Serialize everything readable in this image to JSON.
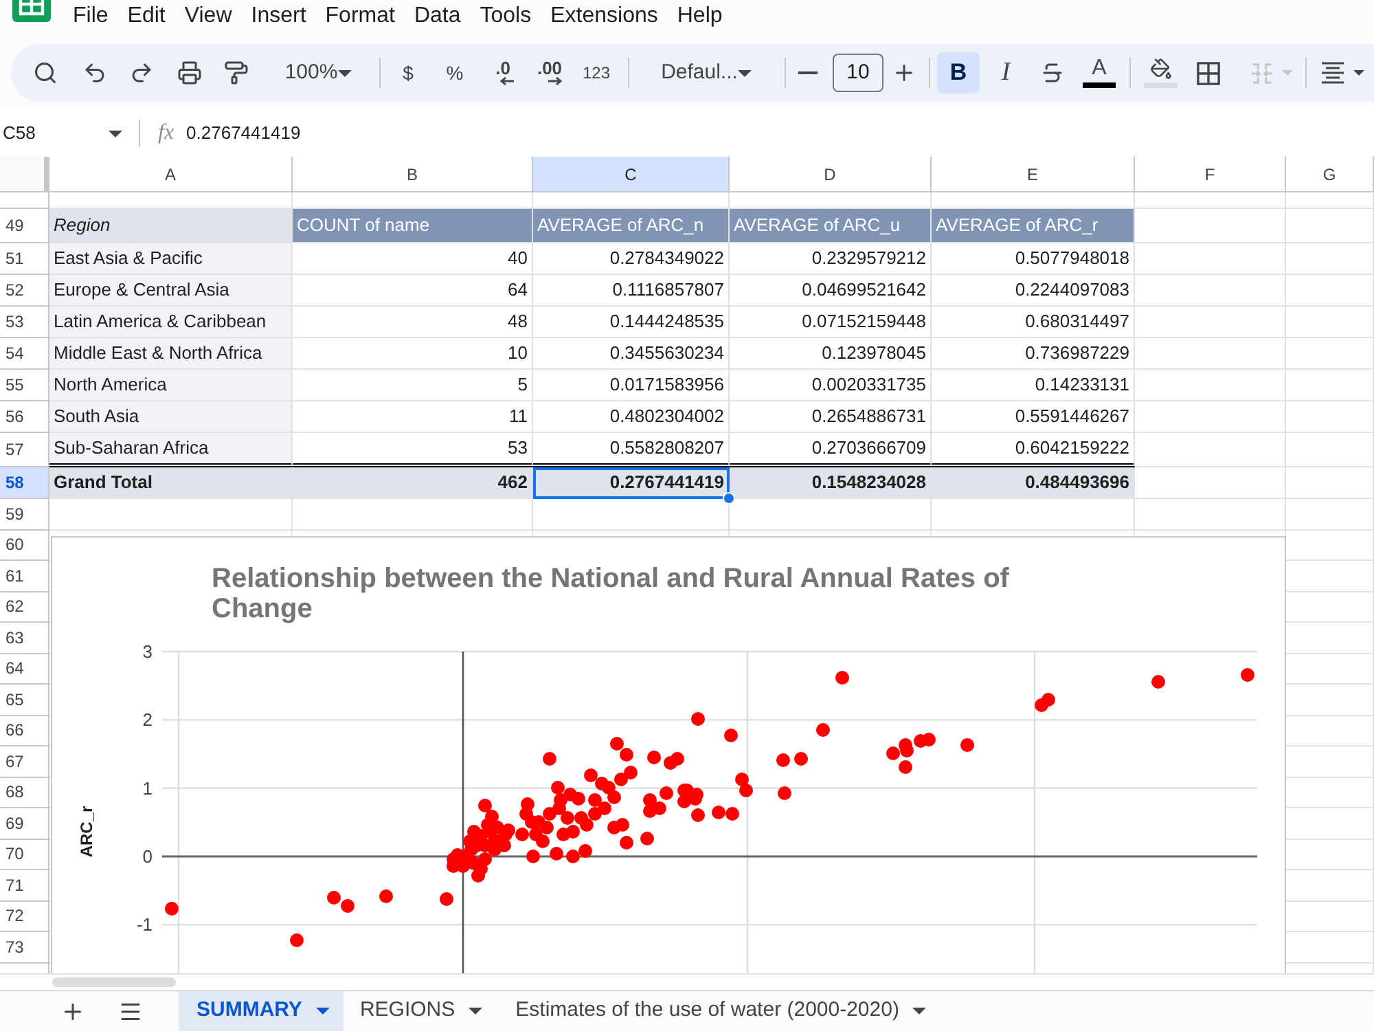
{
  "menu": [
    "File",
    "Edit",
    "View",
    "Insert",
    "Format",
    "Data",
    "Tools",
    "Extensions",
    "Help"
  ],
  "toolbar": {
    "zoom": "100%",
    "currency": "$",
    "percent": "%",
    "decrease_decimals": ".0",
    "increase_decimals": ".00",
    "number_format": "123",
    "font": "Defaul...",
    "font_size": "10",
    "styles": [
      {
        "kind": "bold",
        "label": "B",
        "selected": true
      },
      {
        "kind": "italic",
        "label": "I",
        "selected": false
      }
    ],
    "text_color": "A",
    "merge": {
      "disabled": true
    }
  },
  "formula_bar": {
    "cell_reference": "C58",
    "function_label": "fx",
    "value": "0.2767441419"
  },
  "grid": {
    "columns": [
      {
        "label": "A",
        "selected": false
      },
      {
        "label": "B",
        "selected": false
      },
      {
        "label": "C",
        "selected": true
      },
      {
        "label": "D",
        "selected": false
      },
      {
        "label": "E",
        "selected": false
      },
      {
        "label": "F",
        "selected": false
      },
      {
        "label": "G",
        "selected": false
      }
    ],
    "rows": [
      {
        "number": "49",
        "selected": false,
        "kind": "pivot_header",
        "cells": [
          {
            "text": "Region",
            "selected": false
          },
          {
            "text": "COUNT of name",
            "selected": false
          },
          {
            "text": "AVERAGE of ARC_n",
            "selected": false
          },
          {
            "text": "AVERAGE of ARC_u",
            "selected": false
          },
          {
            "text": "AVERAGE of ARC_r",
            "selected": false
          }
        ]
      },
      {
        "number": "51",
        "selected": false,
        "kind": "pivot_row",
        "cells": [
          {
            "text": "East Asia & Pacific",
            "selected": false
          },
          {
            "text": "40",
            "selected": false
          },
          {
            "text": "0.2784349022",
            "selected": false
          },
          {
            "text": "0.2329579212",
            "selected": false
          },
          {
            "text": "0.5077948018",
            "selected": false
          }
        ]
      },
      {
        "number": "52",
        "selected": false,
        "kind": "pivot_row",
        "cells": [
          {
            "text": "Europe & Central Asia",
            "selected": false
          },
          {
            "text": "64",
            "selected": false
          },
          {
            "text": "0.1116857807",
            "selected": false
          },
          {
            "text": "0.04699521642",
            "selected": false
          },
          {
            "text": "0.2244097083",
            "selected": false
          }
        ]
      },
      {
        "number": "53",
        "selected": false,
        "kind": "pivot_row",
        "cells": [
          {
            "text": "Latin America & Caribbean",
            "selected": false
          },
          {
            "text": "48",
            "selected": false
          },
          {
            "text": "0.1444248535",
            "selected": false
          },
          {
            "text": "0.07152159448",
            "selected": false
          },
          {
            "text": "0.680314497",
            "selected": false
          }
        ]
      },
      {
        "number": "54",
        "selected": false,
        "kind": "pivot_row",
        "cells": [
          {
            "text": "Middle East & North Africa",
            "selected": false
          },
          {
            "text": "10",
            "selected": false
          },
          {
            "text": "0.3455630234",
            "selected": false
          },
          {
            "text": "0.123978045",
            "selected": false
          },
          {
            "text": "0.736987229",
            "selected": false
          }
        ]
      },
      {
        "number": "55",
        "selected": false,
        "kind": "pivot_row",
        "cells": [
          {
            "text": "North America",
            "selected": false
          },
          {
            "text": "5",
            "selected": false
          },
          {
            "text": "0.0171583956",
            "selected": false
          },
          {
            "text": "0.0020331735",
            "selected": false
          },
          {
            "text": "0.14233131",
            "selected": false
          }
        ]
      },
      {
        "number": "56",
        "selected": false,
        "kind": "pivot_row",
        "cells": [
          {
            "text": "South Asia",
            "selected": false
          },
          {
            "text": "11",
            "selected": false
          },
          {
            "text": "0.4802304002",
            "selected": false
          },
          {
            "text": "0.2654886731",
            "selected": false
          },
          {
            "text": "0.5591446267",
            "selected": false
          }
        ]
      },
      {
        "number": "57",
        "selected": false,
        "kind": "pivot_row",
        "cells": [
          {
            "text": "Sub-Saharan Africa",
            "selected": false
          },
          {
            "text": "53",
            "selected": false
          },
          {
            "text": "0.5582808207",
            "selected": false
          },
          {
            "text": "0.2703666709",
            "selected": false
          },
          {
            "text": "0.6042159222",
            "selected": false
          }
        ]
      },
      {
        "number": "58",
        "selected": true,
        "kind": "pivot_total",
        "cells": [
          {
            "text": "Grand Total",
            "selected": false
          },
          {
            "text": "462",
            "selected": false
          },
          {
            "text": "0.2767441419",
            "selected": true
          },
          {
            "text": "0.1548234028",
            "selected": false
          },
          {
            "text": "0.484493696",
            "selected": false
          }
        ]
      },
      {
        "number": "59",
        "selected": false,
        "kind": "empty"
      },
      {
        "number": "60",
        "selected": false,
        "kind": "empty"
      },
      {
        "number": "61",
        "selected": false,
        "kind": "empty"
      },
      {
        "number": "62",
        "selected": false,
        "kind": "empty"
      },
      {
        "number": "63",
        "selected": false,
        "kind": "empty"
      },
      {
        "number": "64",
        "selected": false,
        "kind": "empty"
      },
      {
        "number": "65",
        "selected": false,
        "kind": "empty"
      },
      {
        "number": "66",
        "selected": false,
        "kind": "empty"
      },
      {
        "number": "67",
        "selected": false,
        "kind": "empty"
      },
      {
        "number": "68",
        "selected": false,
        "kind": "empty"
      },
      {
        "number": "69",
        "selected": false,
        "kind": "empty"
      },
      {
        "number": "70",
        "selected": false,
        "kind": "empty"
      },
      {
        "number": "71",
        "selected": false,
        "kind": "empty"
      },
      {
        "number": "72",
        "selected": false,
        "kind": "empty"
      },
      {
        "number": "73",
        "selected": false,
        "kind": "empty"
      }
    ]
  },
  "chart": {
    "title": "Relationship between the National and Rural Annual Rates of Change",
    "ylabel": "ARC_r",
    "y_tick_labels": [
      "3",
      "2",
      "1",
      "0",
      "-1"
    ]
  },
  "sheet_tabs": [
    {
      "label": "SUMMARY",
      "selected": true
    },
    {
      "label": "REGIONS",
      "selected": false
    },
    {
      "label": "Estimates of the use of water (2000-2020)",
      "selected": false
    }
  ]
}
